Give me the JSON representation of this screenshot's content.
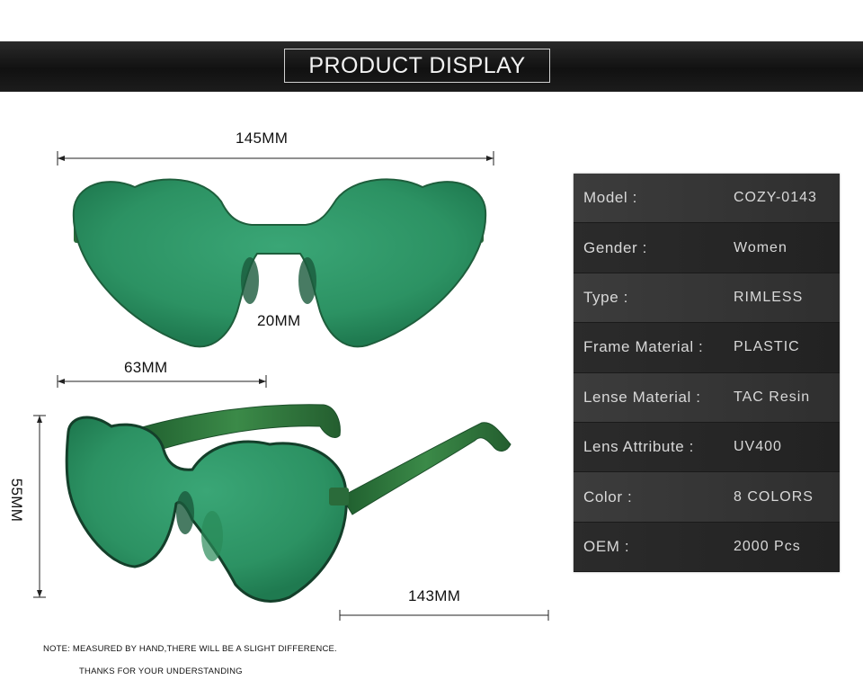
{
  "header": {
    "title": "PRODUCT DISPLAY"
  },
  "dimensions": {
    "total_width": "145MM",
    "bridge": "20MM",
    "lens_width": "63MM",
    "lens_height": "55MM",
    "temple_length": "143MM"
  },
  "specs": [
    {
      "label": "Model :",
      "value": "COZY-0143"
    },
    {
      "label": "Gender :",
      "value": "Women"
    },
    {
      "label": "Type :",
      "value": "RIMLESS"
    },
    {
      "label": "Frame Material :",
      "value": "PLASTIC"
    },
    {
      "label": "Lense Material :",
      "value": "TAC Resin"
    },
    {
      "label": "Lens Attribute :",
      "value": "UV400"
    },
    {
      "label": "Color :",
      "value": "8 COLORS"
    },
    {
      "label": "OEM :",
      "value": "2000 Pcs"
    }
  ],
  "footer": {
    "note": "NOTE: MEASURED BY HAND,THERE WILL BE A SLIGHT DIFFERENCE.",
    "thanks": "THANKS FOR YOUR UNDERSTANDING"
  },
  "colors": {
    "lens": "#2f9a6a",
    "lens_dark": "#1f6e48",
    "temple": "#2d7a3e",
    "banner": "#1a1a1a"
  },
  "images": {
    "front_view": "heart-sunglasses-front",
    "side_view": "heart-sunglasses-side"
  }
}
